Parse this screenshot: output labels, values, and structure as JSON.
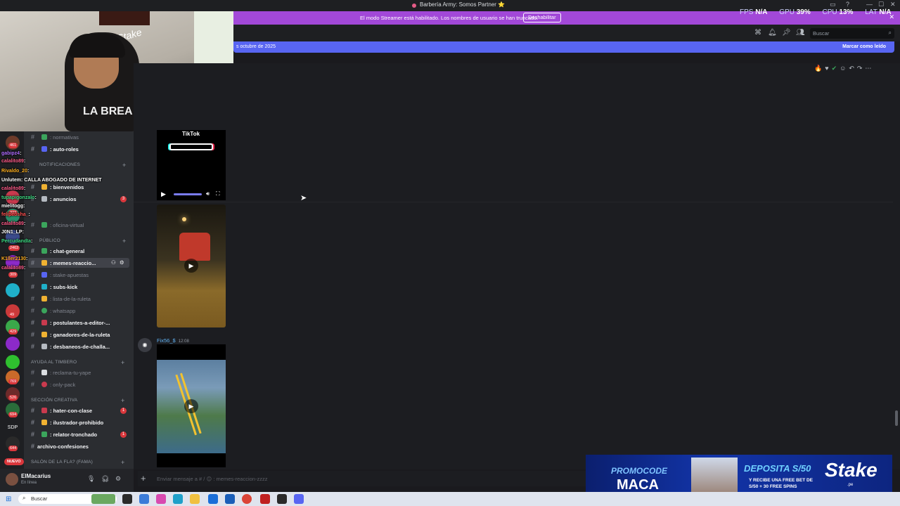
{
  "window": {
    "title": "Barbería Army: Somos Partner ⭐",
    "controls": [
      "—",
      "☐",
      "✕"
    ]
  },
  "streamer_banner": {
    "text": "El modo Streamer está habilitado. Los nombres de usuario se han truncado.",
    "button": "Deshabilitar"
  },
  "header": {
    "search_placeholder": "Buscar",
    "icons": [
      "threads-icon",
      "bell-icon",
      "pin-icon",
      "members-icon"
    ]
  },
  "new_messages_bar": {
    "date_text": "s octubre de 2025",
    "mark_read": "Marcar como leído"
  },
  "stats": {
    "fps_label": "FPS",
    "fps_value": "N/A",
    "gpu_label": "GPU",
    "gpu_value": "39%",
    "cpu_label": "CPU",
    "cpu_value": "13%",
    "lat_label": "LAT",
    "lat_value": "N/A"
  },
  "webcam": {
    "logo": "Stake",
    "shirt": "LA BREA",
    "tiktok": "TikTok"
  },
  "sidebar": {
    "channels": [
      {
        "name": ": normativas",
        "style": "muted"
      },
      {
        "name": ": auto-roles",
        "style": "bright"
      },
      {
        "name": ": bienvenidos",
        "style": "bright"
      },
      {
        "name": ": anuncios",
        "style": "bright",
        "badge": "3"
      },
      {
        "name": ": oficina-virtual",
        "style": "muted"
      },
      {
        "name": ": chat-general",
        "style": "bright"
      },
      {
        "name": ": memes-reaccio...",
        "style": "sel"
      },
      {
        "name": ": stake-apuestas",
        "style": "muted"
      },
      {
        "name": ": subs-kick",
        "style": "bright"
      },
      {
        "name": ": lista-de-la-ruleta",
        "style": "muted"
      },
      {
        "name": ": whatsapp",
        "style": "muted"
      },
      {
        "name": ": postulantes-a-editor-...",
        "style": "bright"
      },
      {
        "name": ": ganadores-de-la-ruleta",
        "style": "bright"
      },
      {
        "name": ": desbaneos-de-challa...",
        "style": "bright"
      },
      {
        "name": ": reclama-tu-yape",
        "style": "muted"
      },
      {
        "name": ": only-pack",
        "style": "muted"
      },
      {
        "name": ": hater-con-clase",
        "style": "bright",
        "badge": "1"
      },
      {
        "name": ": ilustrador-prohibido",
        "style": "bright"
      },
      {
        "name": ": relator-tronchado",
        "style": "bright",
        "badge": "1"
      },
      {
        "name": "archivo-confesiones",
        "style": "bright"
      }
    ],
    "categories": {
      "notificaciones": "NOTIFICACIONES",
      "publico": "PÚBLICO",
      "ayuda": "AYUDA AL TIMBERO",
      "creativa": "SECCIÓN CREATIVA",
      "salon": "SALÓN DE LA FLA? (FAMA)"
    }
  },
  "twitch_chat": [
    {
      "user": "gabipz4",
      "msg": ":",
      "color": "#b06cff"
    },
    {
      "user": "calalito89",
      "msg": ":",
      "color": "#ff5c8a"
    },
    {
      "user": "Rivaldo_20",
      "msg": ":",
      "color": "#ffb020"
    },
    {
      "user": "Unlutem",
      "msg": ": CALLA ABOGADO DE INTERNET",
      "color": "#ffffff"
    },
    {
      "user": "calalito89",
      "msg": ":",
      "color": "#ff5c8a"
    },
    {
      "user": "tupapigonzalo",
      "msg": ":",
      "color": "#3ddc84"
    },
    {
      "user": "mielitogg",
      "msg": ":",
      "color": "#ffffff"
    },
    {
      "user": "felipeosha_",
      "msg": ":",
      "color": "#ff5050"
    },
    {
      "user": "calalito89",
      "msg": ":",
      "color": "#ff5c8a"
    },
    {
      "user": "J0N1_LP",
      "msg": ":",
      "color": "#ffffff"
    },
    {
      "user": "PercudandIa",
      "msg": ":",
      "color": "#3ddc84"
    },
    {
      "user": "K1ller2130",
      "msg": ":",
      "color": "#ffb020"
    },
    {
      "user": "calalito89",
      "msg": ":",
      "color": "#ff5c8a"
    }
  ],
  "server_counts": [
    "461",
    "323",
    "2463",
    "309",
    "49",
    "429",
    "769",
    "526",
    "694",
    "644"
  ],
  "server_labels": {
    "sdp": "SDP",
    "nuevo": "NUEVO"
  },
  "message": {
    "username": "Fix56_$",
    "time": "12:08"
  },
  "composer": {
    "placeholder": "Enviar mensaje a # / 😊 : memes-reaccion-zzzz"
  },
  "user_panel": {
    "name": "ElMacarius",
    "status": "En línea"
  },
  "ad": {
    "promo": "PROMOCODE",
    "code": "MACA",
    "deposit": "DEPOSITA S/50",
    "sub": "Y RECIBE UNA FREE BET DE S/50 + 30 FREE SPINS",
    "brand": "Stake",
    "domain": ".pe"
  },
  "taskbar": {
    "search": "Buscar"
  },
  "colors": {
    "accent": "#5865f2",
    "streamer": "#a248d8",
    "danger": "#da373c"
  }
}
